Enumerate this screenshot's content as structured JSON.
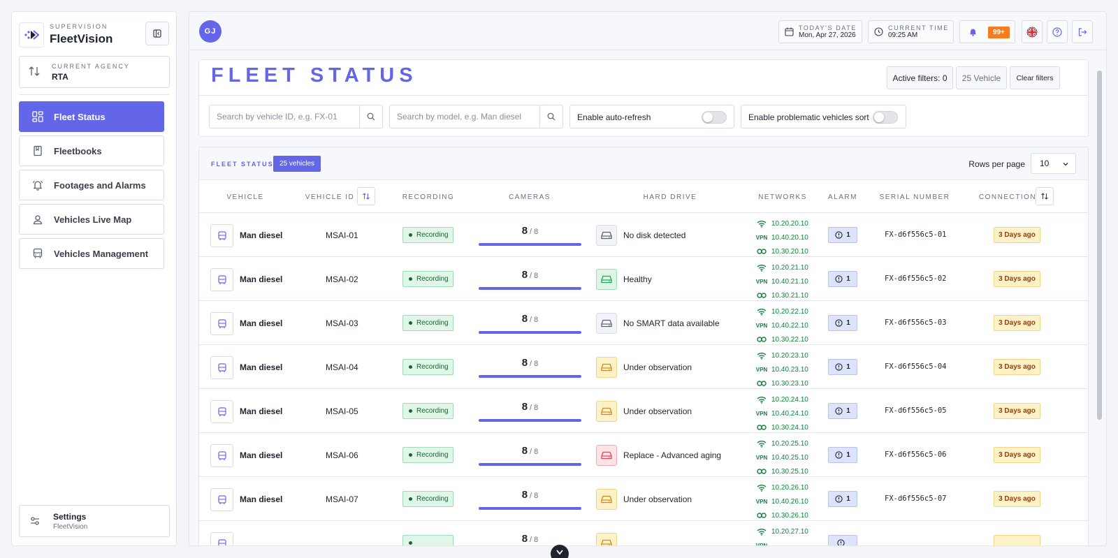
{
  "brand": {
    "supertitle": "SUPERVISION",
    "name": "FleetVision"
  },
  "agency": {
    "label": "CURRENT AGENCY",
    "value": "RTA"
  },
  "nav": {
    "items": [
      {
        "label": "Fleet Status",
        "icon": "grid-icon",
        "active": true
      },
      {
        "label": "Fleetbooks",
        "icon": "book-icon",
        "active": false
      },
      {
        "label": "Footages and Alarms",
        "icon": "bell-icon",
        "active": false
      },
      {
        "label": "Vehicles Live Map",
        "icon": "map-pin-icon",
        "active": false
      },
      {
        "label": "Vehicles Management",
        "icon": "bus-icon",
        "active": false
      }
    ]
  },
  "settings": {
    "label": "Settings",
    "sublabel": "FleetVision"
  },
  "topbar": {
    "avatar_initials": "GJ",
    "date_label": "TODAY'S DATE",
    "date_value": "Mon, Apr 27, 2026",
    "time_label": "CURRENT TIME",
    "time_value": "09:25 AM",
    "notifications_badge": "99+"
  },
  "status": {
    "title": "FLEET STATUS",
    "active_filters": "Active filters: 0",
    "vehicle_count": "25 Vehicle",
    "clear_filters": "Clear filters",
    "search_id_placeholder": "Search by vehicle ID, e.g. FX-01",
    "search_model_placeholder": "Search by model, e.g. Man diesel",
    "auto_refresh_label": "Enable auto-refresh",
    "problematic_sort_label": "Enable problematic vehicles sort"
  },
  "table": {
    "title": "FLEET STATUS",
    "count_badge": "25 vehicles",
    "rows_per_page_label": "Rows per page",
    "rows_per_page_value": "10",
    "columns": {
      "vehicle": "VEHICLE",
      "vehicle_id": "VEHICLE ID",
      "recording": "RECORDING",
      "cameras": "CAMERAS",
      "hard_drive": "HARD DRIVE",
      "networks": "NETWORKS",
      "alarm": "ALARM",
      "serial": "SERIAL NUMBER",
      "connection": "CONNECTION"
    },
    "rows": [
      {
        "vehicle": "Man diesel",
        "id": "MSAI-01",
        "recording": "Recording",
        "cams": "8",
        "cams_total": "/ 8",
        "hd_status": "No disk detected",
        "hd_state": "neutral",
        "net_wifi": "10.20.20.10",
        "net_vpn": "10.40.20.10",
        "net_link": "10.30.20.10",
        "alarm": "1",
        "serial": "FX-d6f556c5-01",
        "connection": "3 Days ago"
      },
      {
        "vehicle": "Man diesel",
        "id": "MSAI-02",
        "recording": "Recording",
        "cams": "8",
        "cams_total": "/ 8",
        "hd_status": "Healthy",
        "hd_state": "ok",
        "net_wifi": "10.20.21.10",
        "net_vpn": "10.40.21.10",
        "net_link": "10.30.21.10",
        "alarm": "1",
        "serial": "FX-d6f556c5-02",
        "connection": "3 Days ago"
      },
      {
        "vehicle": "Man diesel",
        "id": "MSAI-03",
        "recording": "Recording",
        "cams": "8",
        "cams_total": "/ 8",
        "hd_status": "No SMART data available",
        "hd_state": "neutral",
        "net_wifi": "10.20.22.10",
        "net_vpn": "10.40.22.10",
        "net_link": "10.30.22.10",
        "alarm": "1",
        "serial": "FX-d6f556c5-03",
        "connection": "3 Days ago"
      },
      {
        "vehicle": "Man diesel",
        "id": "MSAI-04",
        "recording": "Recording",
        "cams": "8",
        "cams_total": "/ 8",
        "hd_status": "Under observation",
        "hd_state": "warn",
        "net_wifi": "10.20.23.10",
        "net_vpn": "10.40.23.10",
        "net_link": "10.30.23.10",
        "alarm": "1",
        "serial": "FX-d6f556c5-04",
        "connection": "3 Days ago"
      },
      {
        "vehicle": "Man diesel",
        "id": "MSAI-05",
        "recording": "Recording",
        "cams": "8",
        "cams_total": "/ 8",
        "hd_status": "Under observation",
        "hd_state": "warn",
        "net_wifi": "10.20.24.10",
        "net_vpn": "10.40.24.10",
        "net_link": "10.30.24.10",
        "alarm": "1",
        "serial": "FX-d6f556c5-05",
        "connection": "3 Days ago"
      },
      {
        "vehicle": "Man diesel",
        "id": "MSAI-06",
        "recording": "Recording",
        "cams": "8",
        "cams_total": "/ 8",
        "hd_status": "Replace - Advanced aging",
        "hd_state": "bad",
        "net_wifi": "10.20.25.10",
        "net_vpn": "10.40.25.10",
        "net_link": "10.30.25.10",
        "alarm": "1",
        "serial": "FX-d6f556c5-06",
        "connection": "3 Days ago"
      },
      {
        "vehicle": "Man diesel",
        "id": "MSAI-07",
        "recording": "Recording",
        "cams": "8",
        "cams_total": "/ 8",
        "hd_status": "Under observation",
        "hd_state": "warn",
        "net_wifi": "10.20.26.10",
        "net_vpn": "10.40.26.10",
        "net_link": "10.30.26.10",
        "alarm": "1",
        "serial": "FX-d6f556c5-07",
        "connection": "3 Days ago"
      },
      {
        "vehicle": "",
        "id": "",
        "recording": "",
        "cams": "8",
        "cams_total": "/ 8",
        "hd_status": "",
        "hd_state": "warn",
        "net_wifi": "10.20.27.10",
        "net_vpn": "",
        "net_link": "",
        "alarm": "",
        "serial": "",
        "connection": ""
      }
    ]
  },
  "colors": {
    "accent": "#6366e9",
    "recording_bg": "#dff6e8",
    "network_green": "#15803d",
    "connection_warn": "#fdf1c7",
    "notification_orange": "#f57c1f",
    "hd_ok": "#22a55a",
    "hd_warn": "#d08a1a",
    "hd_bad": "#e0475b",
    "hd_neutral": "#5b6070"
  }
}
